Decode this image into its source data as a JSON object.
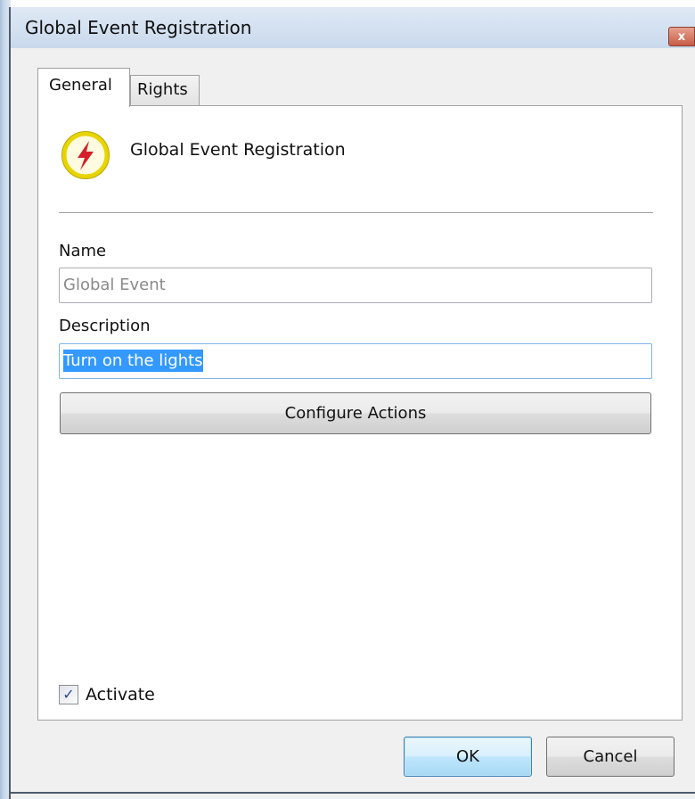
{
  "window": {
    "title": "Global Event Registration",
    "close_icon": "close-icon"
  },
  "tabs": [
    {
      "label": "General",
      "selected": true
    },
    {
      "label": "Rights",
      "selected": false
    }
  ],
  "header": {
    "icon": "lightning-bolt-icon",
    "title": "Global Event Registration"
  },
  "form": {
    "name_label": "Name",
    "name_value": "Global Event",
    "description_label": "Description",
    "description_value": "Turn on the lights",
    "configure_label": "Configure Actions",
    "activate_label": "Activate",
    "activate_checked": true
  },
  "buttons": {
    "ok_label": "OK",
    "cancel_label": "Cancel"
  },
  "colors": {
    "selection": "#3399ff",
    "icon_ring": "#e8d400",
    "icon_bolt": "#d4202a"
  }
}
